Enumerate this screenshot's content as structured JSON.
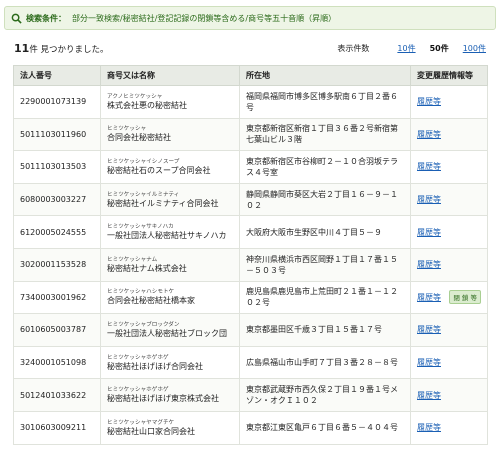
{
  "condition": {
    "label": "検索条件：",
    "text": "部分一致検索/秘密結社/登記記録の閉鎖等含める/商号等五十音順（昇順）"
  },
  "results": {
    "count": "11",
    "count_suffix": "件 見つかりました。",
    "per_page_label": "表示件数",
    "per_page_options": [
      "10件",
      "50件",
      "100件"
    ],
    "per_page_selected": "50件"
  },
  "table": {
    "headers": [
      "法人番号",
      "商号又は名称",
      "所在地",
      "変更履歴情報等"
    ],
    "rows": [
      {
        "number": "2290001073139",
        "kana": "アクノヒミツケッシャ",
        "name": "株式会社悪の秘密結社",
        "address": "福岡県福岡市博多区博多駅南６丁目２番６号",
        "history": "履歴等",
        "badge": ""
      },
      {
        "number": "5011103011960",
        "kana": "ヒミツケッシャ",
        "name": "合同会社秘密結社",
        "address": "東京都新宿区新宿１丁目３６番２号新宿第七葉山ビル３階",
        "history": "履歴等",
        "badge": ""
      },
      {
        "number": "5011103013503",
        "kana": "ヒミツケッシャイシノスープ",
        "name": "秘密結社石のスープ合同会社",
        "address": "東京都新宿区市谷柳町２－１０合羽坂テラス４号室",
        "history": "履歴等",
        "badge": ""
      },
      {
        "number": "6080003003227",
        "kana": "ヒミツケッシャイルミナティ",
        "name": "秘密結社イルミナティ合同会社",
        "address": "静岡県静岡市葵区大岩２丁目１６－９－１０２",
        "history": "履歴等",
        "badge": ""
      },
      {
        "number": "6120005024555",
        "kana": "ヒミツケッシャサキノハカ",
        "name": "一般社団法人秘密結社サキノハカ",
        "address": "大阪府大阪市生野区中川４丁目５－９",
        "history": "履歴等",
        "badge": ""
      },
      {
        "number": "3020001153528",
        "kana": "ヒミツケッシャナム",
        "name": "秘密結社ナム株式会社",
        "address": "神奈川県横浜市西区岡野１丁目１７番１５－５０３号",
        "history": "履歴等",
        "badge": ""
      },
      {
        "number": "7340003001962",
        "kana": "ヒミツケッシャハシモトケ",
        "name": "合同会社秘密結社橋本家",
        "address": "鹿児島県鹿児島市上荒田町２１番１－１２０２号",
        "history": "履歴等",
        "badge": "閉 鎖 等"
      },
      {
        "number": "6010605003787",
        "kana": "ヒミツケッシャブロックダン",
        "name": "一般社団法人秘密結社ブロック団",
        "address": "東京都墨田区千歳３丁目１５番１７号",
        "history": "履歴等",
        "badge": ""
      },
      {
        "number": "3240001051098",
        "kana": "ヒミツケッシャホゲホゲ",
        "name": "秘密結社ほげほげ合同会社",
        "address": "広島県福山市山手町７丁目３番２８－８号",
        "history": "履歴等",
        "badge": ""
      },
      {
        "number": "5012401033622",
        "kana": "ヒミツケッシャホゲホゲ",
        "name": "秘密結社ほげほげ東京株式会社",
        "address": "東京都武蔵野市西久保２丁目１９番１号メゾン・オクＩ１０２",
        "history": "履歴等",
        "badge": ""
      },
      {
        "number": "3010603009211",
        "kana": "ヒミツケッシャヤマグチケ",
        "name": "秘密結社山口家合同会社",
        "address": "東京都江東区亀戸６丁目６番５－４０４号",
        "history": "履歴等",
        "badge": ""
      }
    ]
  }
}
